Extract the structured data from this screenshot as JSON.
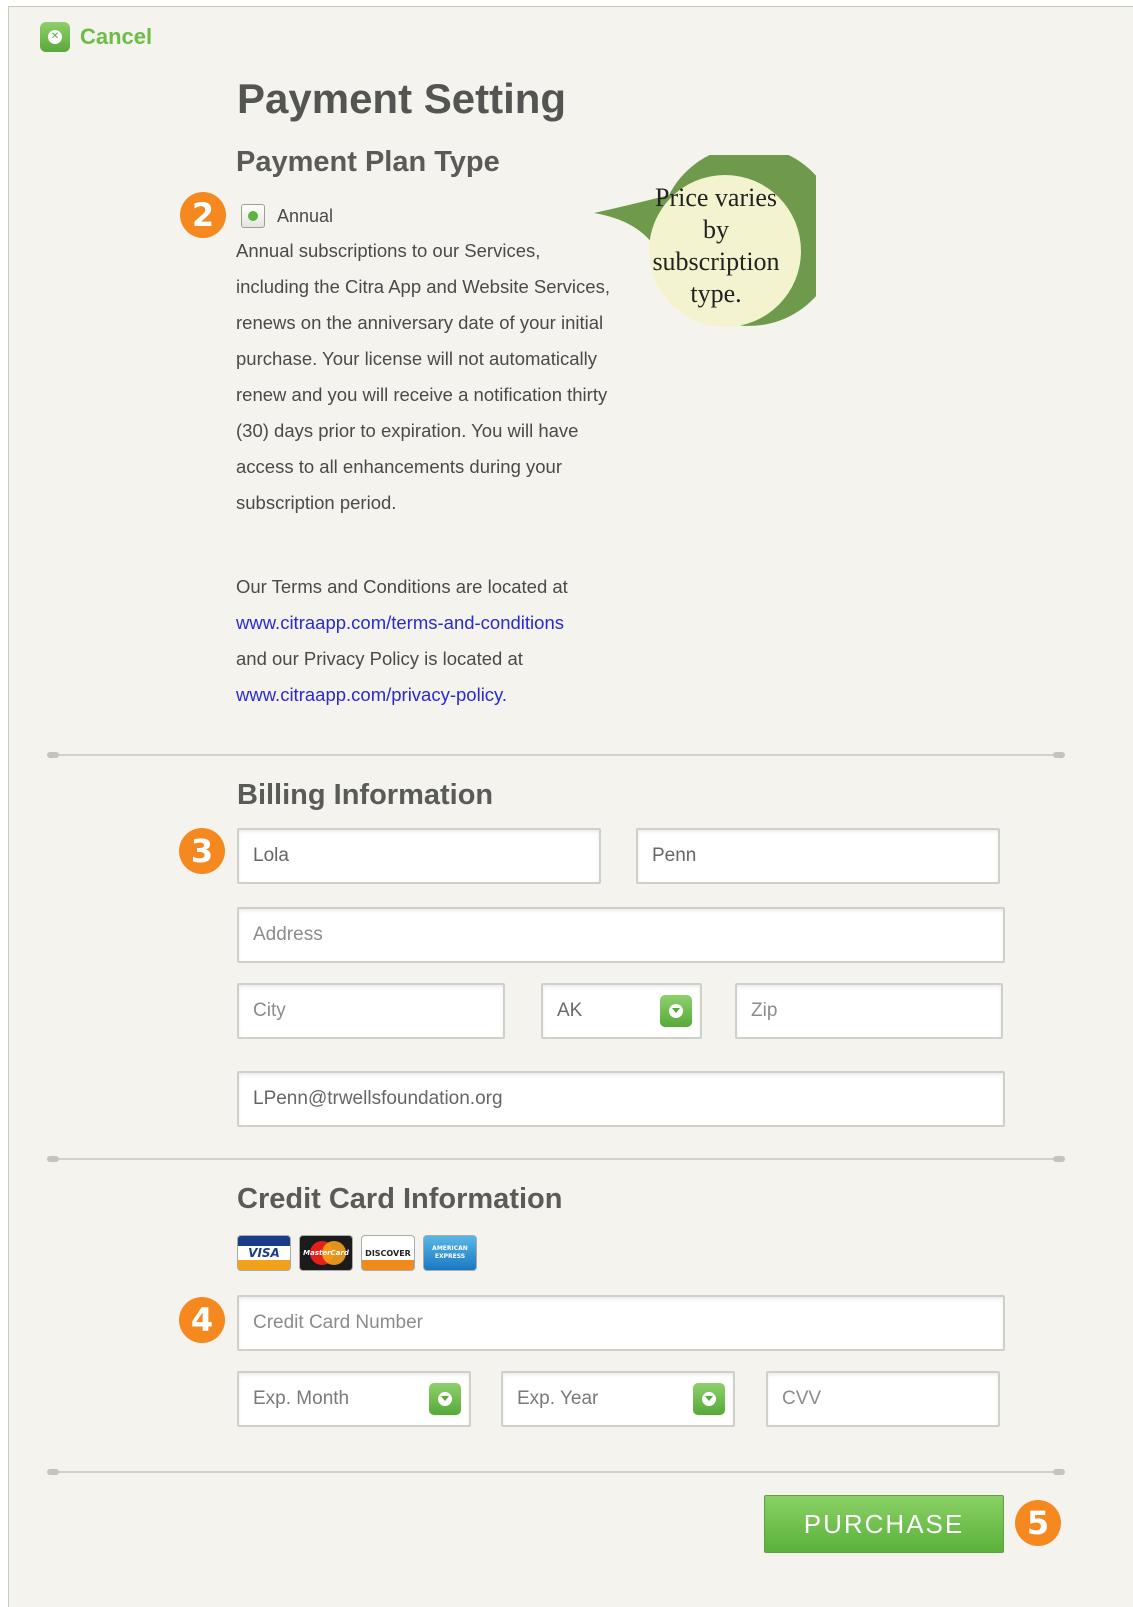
{
  "header": {
    "cancel_label": "Cancel",
    "cancel_icon": "close-icon"
  },
  "page": {
    "title": "Payment Setting"
  },
  "plan": {
    "heading": "Payment Plan Type",
    "step": "2",
    "option_label": "Annual",
    "option_selected": true,
    "description": "Annual subscriptions to our Services, including the Citra App and Website Services, renews on the anniversary date of your initial purchase. Your license will not automatically renew and you will receive a notification thirty (30) days prior to expiration. You will have access to all enhancements during your subscription period.",
    "terms_prefix": "Our Terms and Conditions are located at",
    "terms_link": "www.citraapp.com/terms-and-conditions",
    "privacy_prefix": "and our Privacy Policy is located at",
    "privacy_link": "www.citraapp.com/privacy-policy."
  },
  "callout": {
    "text": "Price varies by subscription type."
  },
  "billing": {
    "heading": "Billing Information",
    "step": "3",
    "first_name": "Lola",
    "last_name": "Penn",
    "address_placeholder": "Address",
    "city_placeholder": "City",
    "state_value": "AK",
    "zip_placeholder": "Zip",
    "email": "LPenn@trwellsfoundation.org"
  },
  "credit_card": {
    "heading": "Credit Card Information",
    "step": "4",
    "card_brands": [
      "VISA",
      "MasterCard",
      "DISCOVER",
      "AMERICAN EXPRESS"
    ],
    "number_placeholder": "Credit Card Number",
    "exp_month_placeholder": "Exp. Month",
    "exp_year_placeholder": "Exp. Year",
    "cvv_placeholder": "CVV"
  },
  "footer": {
    "purchase_label": "PURCHASE",
    "step": "5"
  },
  "colors": {
    "accent_green": "#6bbd45",
    "step_orange": "#f5891f",
    "link_blue": "#2a2ad0",
    "background": "#f4f3ee",
    "callout_fill": "#f3f4cf",
    "callout_border": "#6f9a4c"
  }
}
